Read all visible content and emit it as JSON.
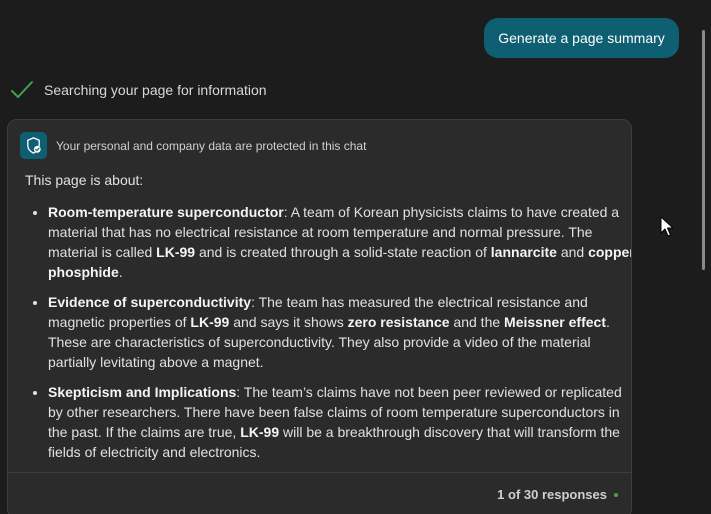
{
  "user_message": {
    "text": "Generate a page summary"
  },
  "status": {
    "icon": "check-icon",
    "text": "Searching your page for information"
  },
  "answer": {
    "privacy": {
      "icon": "shield-icon",
      "text": "Your personal and company data are protected in this chat"
    },
    "intro": "This page is about:",
    "bullets": [
      {
        "segments": [
          {
            "text": "Room-temperature superconductor",
            "bold": true
          },
          {
            "text": ": A team of Korean physicists claims to have created a material that has no electrical resistance at room temperature and normal pressure. The material is called ",
            "bold": false
          },
          {
            "text": "LK-99",
            "bold": true
          },
          {
            "text": " and is created through a solid-state reaction of ",
            "bold": false
          },
          {
            "text": "lannarcite",
            "bold": true
          },
          {
            "text": " and ",
            "bold": false
          },
          {
            "text": "copper phosphide",
            "bold": true
          },
          {
            "text": ".",
            "bold": false
          }
        ]
      },
      {
        "segments": [
          {
            "text": "Evidence of superconductivity",
            "bold": true
          },
          {
            "text": ": The team has measured the electrical resistance and magnetic properties of ",
            "bold": false
          },
          {
            "text": "LK-99",
            "bold": true
          },
          {
            "text": " and says it shows ",
            "bold": false
          },
          {
            "text": "zero resistance",
            "bold": true
          },
          {
            "text": " and the ",
            "bold": false
          },
          {
            "text": "Meissner effect",
            "bold": true
          },
          {
            "text": ". These are characteristics of superconductivity. They also provide a video of the material partially levitating above a magnet.",
            "bold": false
          }
        ]
      },
      {
        "segments": [
          {
            "text": "Skepticism and Implications",
            "bold": true
          },
          {
            "text": ": The team’s claims have not been peer reviewed or replicated by other researchers. There have been false claims of room temperature superconductors in the past. If the claims are true, ",
            "bold": false
          },
          {
            "text": "LK-99",
            "bold": true
          },
          {
            "text": " will be a breakthrough discovery that will transform the fields of electricity and electronics.",
            "bold": false
          }
        ]
      }
    ],
    "footer": {
      "counter": "1 of 30 responses"
    }
  },
  "colors": {
    "background": "#1c1c1c",
    "card": "#2b2b2b",
    "accent": "#0e5f72",
    "check": "#3fa34d"
  }
}
